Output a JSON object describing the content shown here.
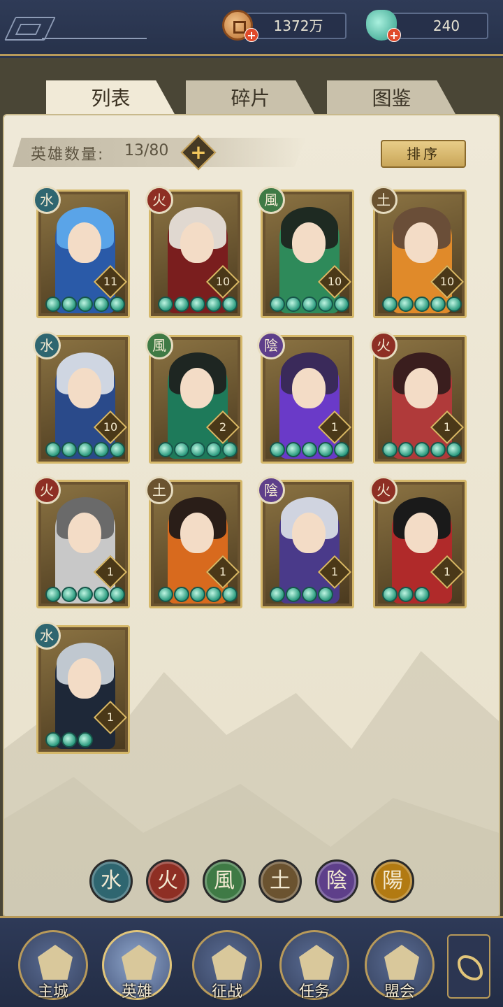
{
  "currency": {
    "coins": "1372万",
    "jade": "240"
  },
  "tabs": [
    {
      "label": "列表",
      "active": true
    },
    {
      "label": "碎片",
      "active": false
    },
    {
      "label": "图鉴",
      "active": false
    }
  ],
  "hero_count": {
    "label": "英雄数量:",
    "value": "13/80"
  },
  "sort_label": "排序",
  "element_glyphs": {
    "water": "水",
    "fire": "火",
    "wind": "風",
    "earth": "土",
    "yin": "陰",
    "yang": "陽"
  },
  "heroes": [
    {
      "element": "water",
      "element_glyph": "水",
      "level": "11",
      "stars": 5,
      "hair": "#5aa4e8",
      "outfit": "#2a5aa8"
    },
    {
      "element": "fire",
      "element_glyph": "火",
      "level": "10",
      "stars": 5,
      "hair": "#e0d8d0",
      "outfit": "#7a1e1e"
    },
    {
      "element": "wind",
      "element_glyph": "風",
      "level": "10",
      "stars": 5,
      "hair": "#1e2a22",
      "outfit": "#2e8a5a"
    },
    {
      "element": "earth",
      "element_glyph": "土",
      "level": "10",
      "stars": 5,
      "hair": "#6a4e38",
      "outfit": "#e08a2a"
    },
    {
      "element": "water",
      "element_glyph": "水",
      "level": "10",
      "stars": 5,
      "hair": "#cfd6e2",
      "outfit": "#2a4a8a"
    },
    {
      "element": "wind",
      "element_glyph": "風",
      "level": "2",
      "stars": 5,
      "hair": "#1e2622",
      "outfit": "#1e7a5a"
    },
    {
      "element": "yin",
      "element_glyph": "陰",
      "level": "1",
      "stars": 5,
      "hair": "#3a2a5a",
      "outfit": "#6a3ac8"
    },
    {
      "element": "fire",
      "element_glyph": "火",
      "level": "1",
      "stars": 5,
      "hair": "#3a1e1e",
      "outfit": "#b03a3a"
    },
    {
      "element": "fire",
      "element_glyph": "火",
      "level": "1",
      "stars": 5,
      "hair": "#6a6a6a",
      "outfit": "#c8c8c8"
    },
    {
      "element": "earth",
      "element_glyph": "土",
      "level": "1",
      "stars": 5,
      "hair": "#2a1e18",
      "outfit": "#d86a1e"
    },
    {
      "element": "yin",
      "element_glyph": "陰",
      "level": "1",
      "stars": 4,
      "hair": "#d0d4e0",
      "outfit": "#4a3a8a"
    },
    {
      "element": "fire",
      "element_glyph": "火",
      "level": "1",
      "stars": 3,
      "hair": "#1a1a1a",
      "outfit": "#b02a2a"
    },
    {
      "element": "water",
      "element_glyph": "水",
      "level": "1",
      "stars": 3,
      "hair": "#c0c8d0",
      "outfit": "#1e2838"
    }
  ],
  "filters": [
    "水",
    "火",
    "風",
    "土",
    "陰",
    "陽"
  ],
  "nav": [
    {
      "label": "主城",
      "active": false
    },
    {
      "label": "英雄",
      "active": true
    },
    {
      "label": "征战",
      "active": false
    },
    {
      "label": "任务",
      "active": false
    },
    {
      "label": "盟会",
      "active": false
    }
  ]
}
